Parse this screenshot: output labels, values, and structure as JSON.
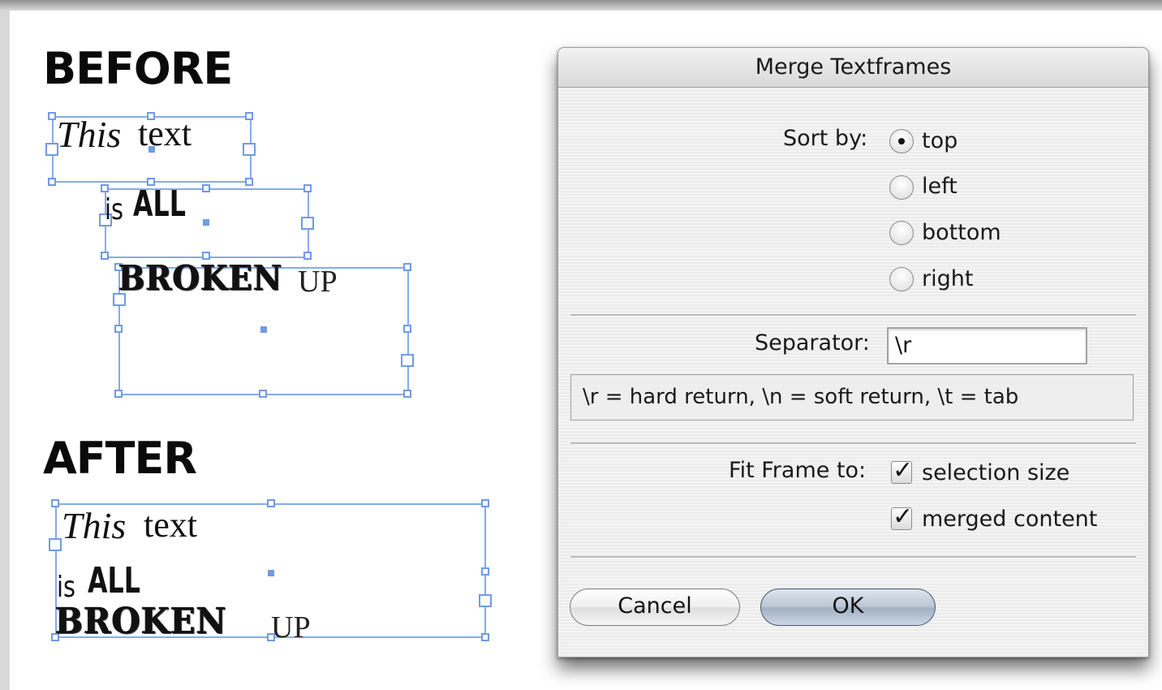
{
  "before_section": {
    "heading": "BEFORE",
    "frames": [
      {
        "italic": "This",
        "text": "text"
      },
      {
        "small": "is",
        "bold": "ALL"
      },
      {
        "broken": "BROKEN",
        "up": "UP"
      }
    ]
  },
  "after_section": {
    "heading": "AFTER",
    "line1_italic": "This",
    "line1_text": "text",
    "line2_small": "is",
    "line2_bold": "ALL",
    "line3_broken": "BROKEN",
    "line3_up": "UP"
  },
  "dialog": {
    "title": "Merge Textframes",
    "sort_label": "Sort by:",
    "sort_options": [
      {
        "label": "top",
        "selected": true
      },
      {
        "label": "left",
        "selected": false
      },
      {
        "label": "bottom",
        "selected": false
      },
      {
        "label": "right",
        "selected": false
      }
    ],
    "separator_label": "Separator:",
    "separator_value": "\\r",
    "separator_hint": "\\r = hard return, \\n = soft return, \\t = tab",
    "fit_label": "Fit Frame to:",
    "fit_options": [
      {
        "label": "selection size",
        "checked": true
      },
      {
        "label": "merged content",
        "checked": true
      }
    ],
    "cancel_label": "Cancel",
    "ok_label": "OK"
  },
  "colors": {
    "frame_border": "#86abe9",
    "ok_button": "#a9b8c9"
  }
}
